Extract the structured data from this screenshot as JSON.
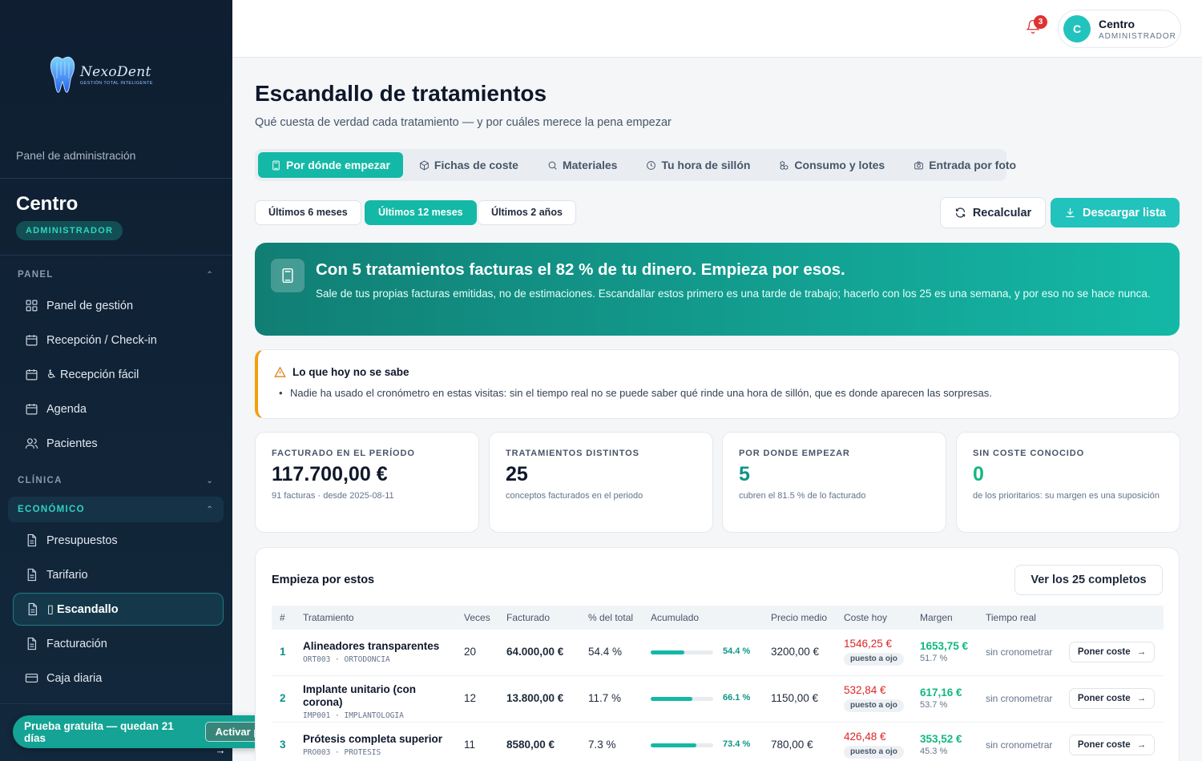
{
  "sidebar": {
    "brand_name": "NexoDent",
    "brand_tagline": "GESTIÓN TOTAL INTELIGENTE",
    "panel_label": "Panel de administración",
    "center_name": "Centro",
    "role": "ADMINISTRADOR",
    "sections": [
      {
        "label": "PANEL",
        "chevron": "⌃"
      },
      {
        "label": "CLÍNICA",
        "chevron": "⌄"
      },
      {
        "label": "ECONÓMICO",
        "chevron": "⌃"
      }
    ],
    "items": [
      {
        "label": "Panel de gestión",
        "icon": "grid-icon"
      },
      {
        "label": "Recepción / Check-in",
        "icon": "calendar-icon"
      },
      {
        "label": "♿ Recepción fácil",
        "icon": "calendar-icon"
      },
      {
        "label": "Agenda",
        "icon": "calendar-icon"
      },
      {
        "label": "Pacientes",
        "icon": "users-icon"
      },
      {
        "label": "Presupuestos",
        "icon": "document-icon"
      },
      {
        "label": "Tarifario",
        "icon": "document-icon"
      },
      {
        "label": "▯ Escandallo",
        "icon": "document-icon"
      },
      {
        "label": "Facturación",
        "icon": "document-icon"
      },
      {
        "label": "Caja diaria",
        "icon": "card-icon"
      }
    ],
    "trial_text": "Prueba gratuita — quedan 21 días",
    "trial_button": "Activar plan →"
  },
  "topbar": {
    "notification_count": "3",
    "avatar_letter": "C",
    "user_name": "Centro",
    "user_role": "ADMINISTRADOR"
  },
  "page": {
    "title": "Escandallo de tratamientos",
    "subtitle": "Qué cuesta de verdad cada tratamiento — y por cuáles merece la pena empezar"
  },
  "tabs": [
    {
      "label": "Por dónde empezar",
      "icon": "calculator-icon"
    },
    {
      "label": "Fichas de coste",
      "icon": "box-icon"
    },
    {
      "label": "Materiales",
      "icon": "search-icon"
    },
    {
      "label": "Tu hora de sillón",
      "icon": "clock-icon"
    },
    {
      "label": "Consumo y lotes",
      "icon": "boxes-icon"
    },
    {
      "label": "Entrada por foto",
      "icon": "camera-icon"
    }
  ],
  "periods": [
    "Últimos 6 meses",
    "Últimos 12 meses",
    "Últimos 2 años"
  ],
  "actions": {
    "recalc": "Recalcular",
    "download": "Descargar lista"
  },
  "hero": {
    "title": "Con 5 tratamientos facturas el 82 % de tu dinero. Empieza por esos.",
    "text": "Sale de tus propias facturas emitidas, no de estimaciones. Escandallar estos primero es una tarde de trabajo; hacerlo con los 25 es una semana, y por eso no se hace nunca."
  },
  "warning": {
    "title": "Lo que hoy no se sabe",
    "item": "Nadie ha usado el cronómetro en estas visitas: sin el tiempo real no se puede saber qué rinde una hora de sillón, que es donde aparecen las sorpresas."
  },
  "kpis": [
    {
      "label": "FACTURADO EN EL PERÍODO",
      "value": "117.700,00 €",
      "sub": "91 facturas · desde 2025-08-11"
    },
    {
      "label": "TRATAMIENTOS DISTINTOS",
      "value": "25",
      "sub": "conceptos facturados en el periodo"
    },
    {
      "label": "POR DONDE EMPEZAR",
      "value": "5",
      "sub": "cubren el 81.5 % de lo facturado"
    },
    {
      "label": "SIN COSTE CONOCIDO",
      "value": "0",
      "sub": "de los prioritarios: su margen es una suposición"
    }
  ],
  "table": {
    "title": "Empieza por estos",
    "view_all": "Ver los 25 completos",
    "headers": [
      "#",
      "Tratamiento",
      "Veces",
      "Facturado",
      "% del total",
      "Acumulado",
      "Precio medio",
      "Coste hoy",
      "Margen",
      "Tiempo real"
    ],
    "rows": [
      {
        "rank": "1",
        "name": "Alineadores transparentes",
        "code": "ORT003 · ORTODONCIA",
        "times": "20",
        "billed": "64.000,00 €",
        "pct": "54.4 %",
        "cum": "54.4 %",
        "cum_value": 54.4,
        "avg": "3200,00 €",
        "cost": "1546,25 €",
        "cost_tag": "puesto a ojo",
        "margin": "1653,75 €",
        "margin_pct": "51.7 %",
        "time": "sin cronometrar",
        "action": "Poner coste"
      },
      {
        "rank": "2",
        "name": "Implante unitario (con corona)",
        "code": "IMP001 · IMPLANTOLOGIA",
        "times": "12",
        "billed": "13.800,00 €",
        "pct": "11.7 %",
        "cum": "66.1 %",
        "cum_value": 66.1,
        "avg": "1150,00 €",
        "cost": "532,84 €",
        "cost_tag": "puesto a ojo",
        "margin": "617,16 €",
        "margin_pct": "53.7 %",
        "time": "sin cronometrar",
        "action": "Poner coste"
      },
      {
        "rank": "3",
        "name": "Prótesis completa superior",
        "code": "PRO003 · PROTESIS",
        "times": "11",
        "billed": "8580,00 €",
        "pct": "7.3 %",
        "cum": "73.4 %",
        "cum_value": 73.4,
        "avg": "780,00 €",
        "cost": "426,48 €",
        "cost_tag": "puesto a ojo",
        "margin": "353,52 €",
        "margin_pct": "45.3 %",
        "time": "sin cronometrar",
        "action": "Poner coste"
      }
    ]
  }
}
